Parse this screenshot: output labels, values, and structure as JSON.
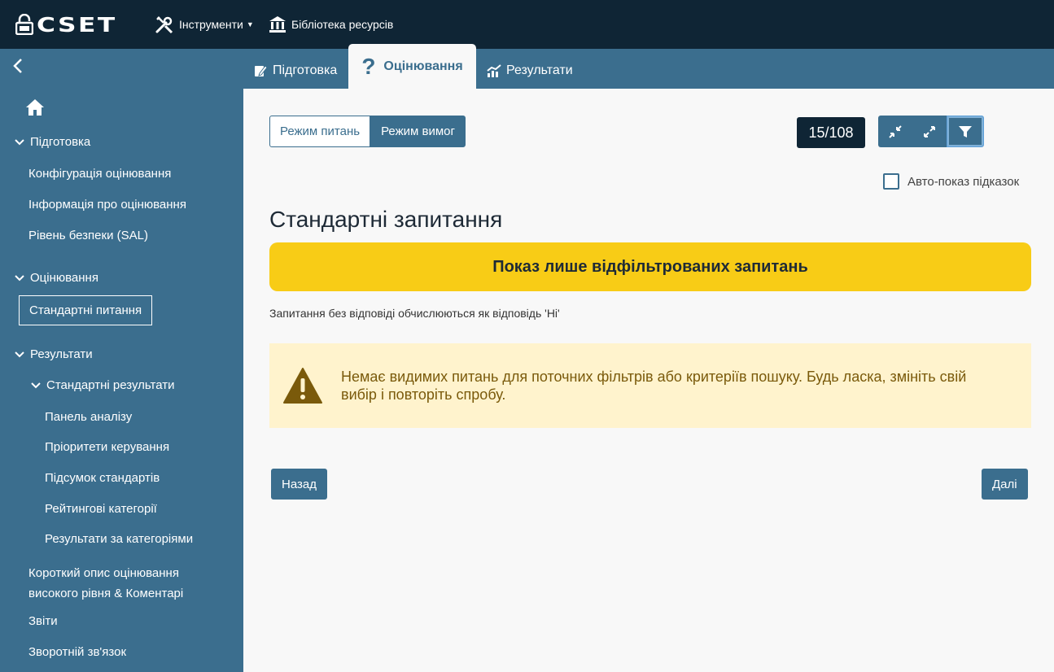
{
  "app": {
    "logo_text": "CSET"
  },
  "topnav": {
    "tools": "Інструменти",
    "library": "Бібліотека ресурсів"
  },
  "tabs": {
    "prepare": "Підготовка",
    "assessment": "Оцінювання",
    "results": "Результати"
  },
  "sidebar": {
    "prepare_group": "Підготовка",
    "prepare_items": [
      "Конфігурація оцінювання",
      "Інформація про оцінювання",
      "Рівень безпеки (SAL)"
    ],
    "assessment_group": "Оцінювання",
    "assessment_items": [
      "Стандартні питання"
    ],
    "results_group": "Результати",
    "std_results_group": "Стандартні результати",
    "std_results_items": [
      "Панель аналізу",
      "Пріоритети керування",
      "Підсумок стандартів",
      "Рейтингові категорії",
      "Результати за категоріями"
    ],
    "summary_line1": "Короткий опис оцінювання",
    "summary_line2": "високого рівня & Коментарі",
    "reports": "Звіти",
    "feedback": "Зворотній зв'язок"
  },
  "main": {
    "mode_questions": "Режим питань",
    "mode_requirements": "Режим вимог",
    "counter": "15/108",
    "auto_hint": "Авто-показ підказок",
    "title": "Стандартні запитання",
    "filter_banner": "Показ лише відфільтрованих запитань",
    "note": "Запитання без відповіді обчислюються як відповідь 'Ні'",
    "warning": "Немає видимих питань для поточних фільтрів або критеріїв пошуку. Будь ласка, змініть свій вибір і повторіть спробу.",
    "back": "Назад",
    "next": "Далі"
  },
  "colors": {
    "topbar": "#0f2535",
    "accent": "#3b6e8e",
    "banner": "#f8cc16",
    "warning_bg": "#fff3cd",
    "warning_text": "#7a5a0b"
  }
}
